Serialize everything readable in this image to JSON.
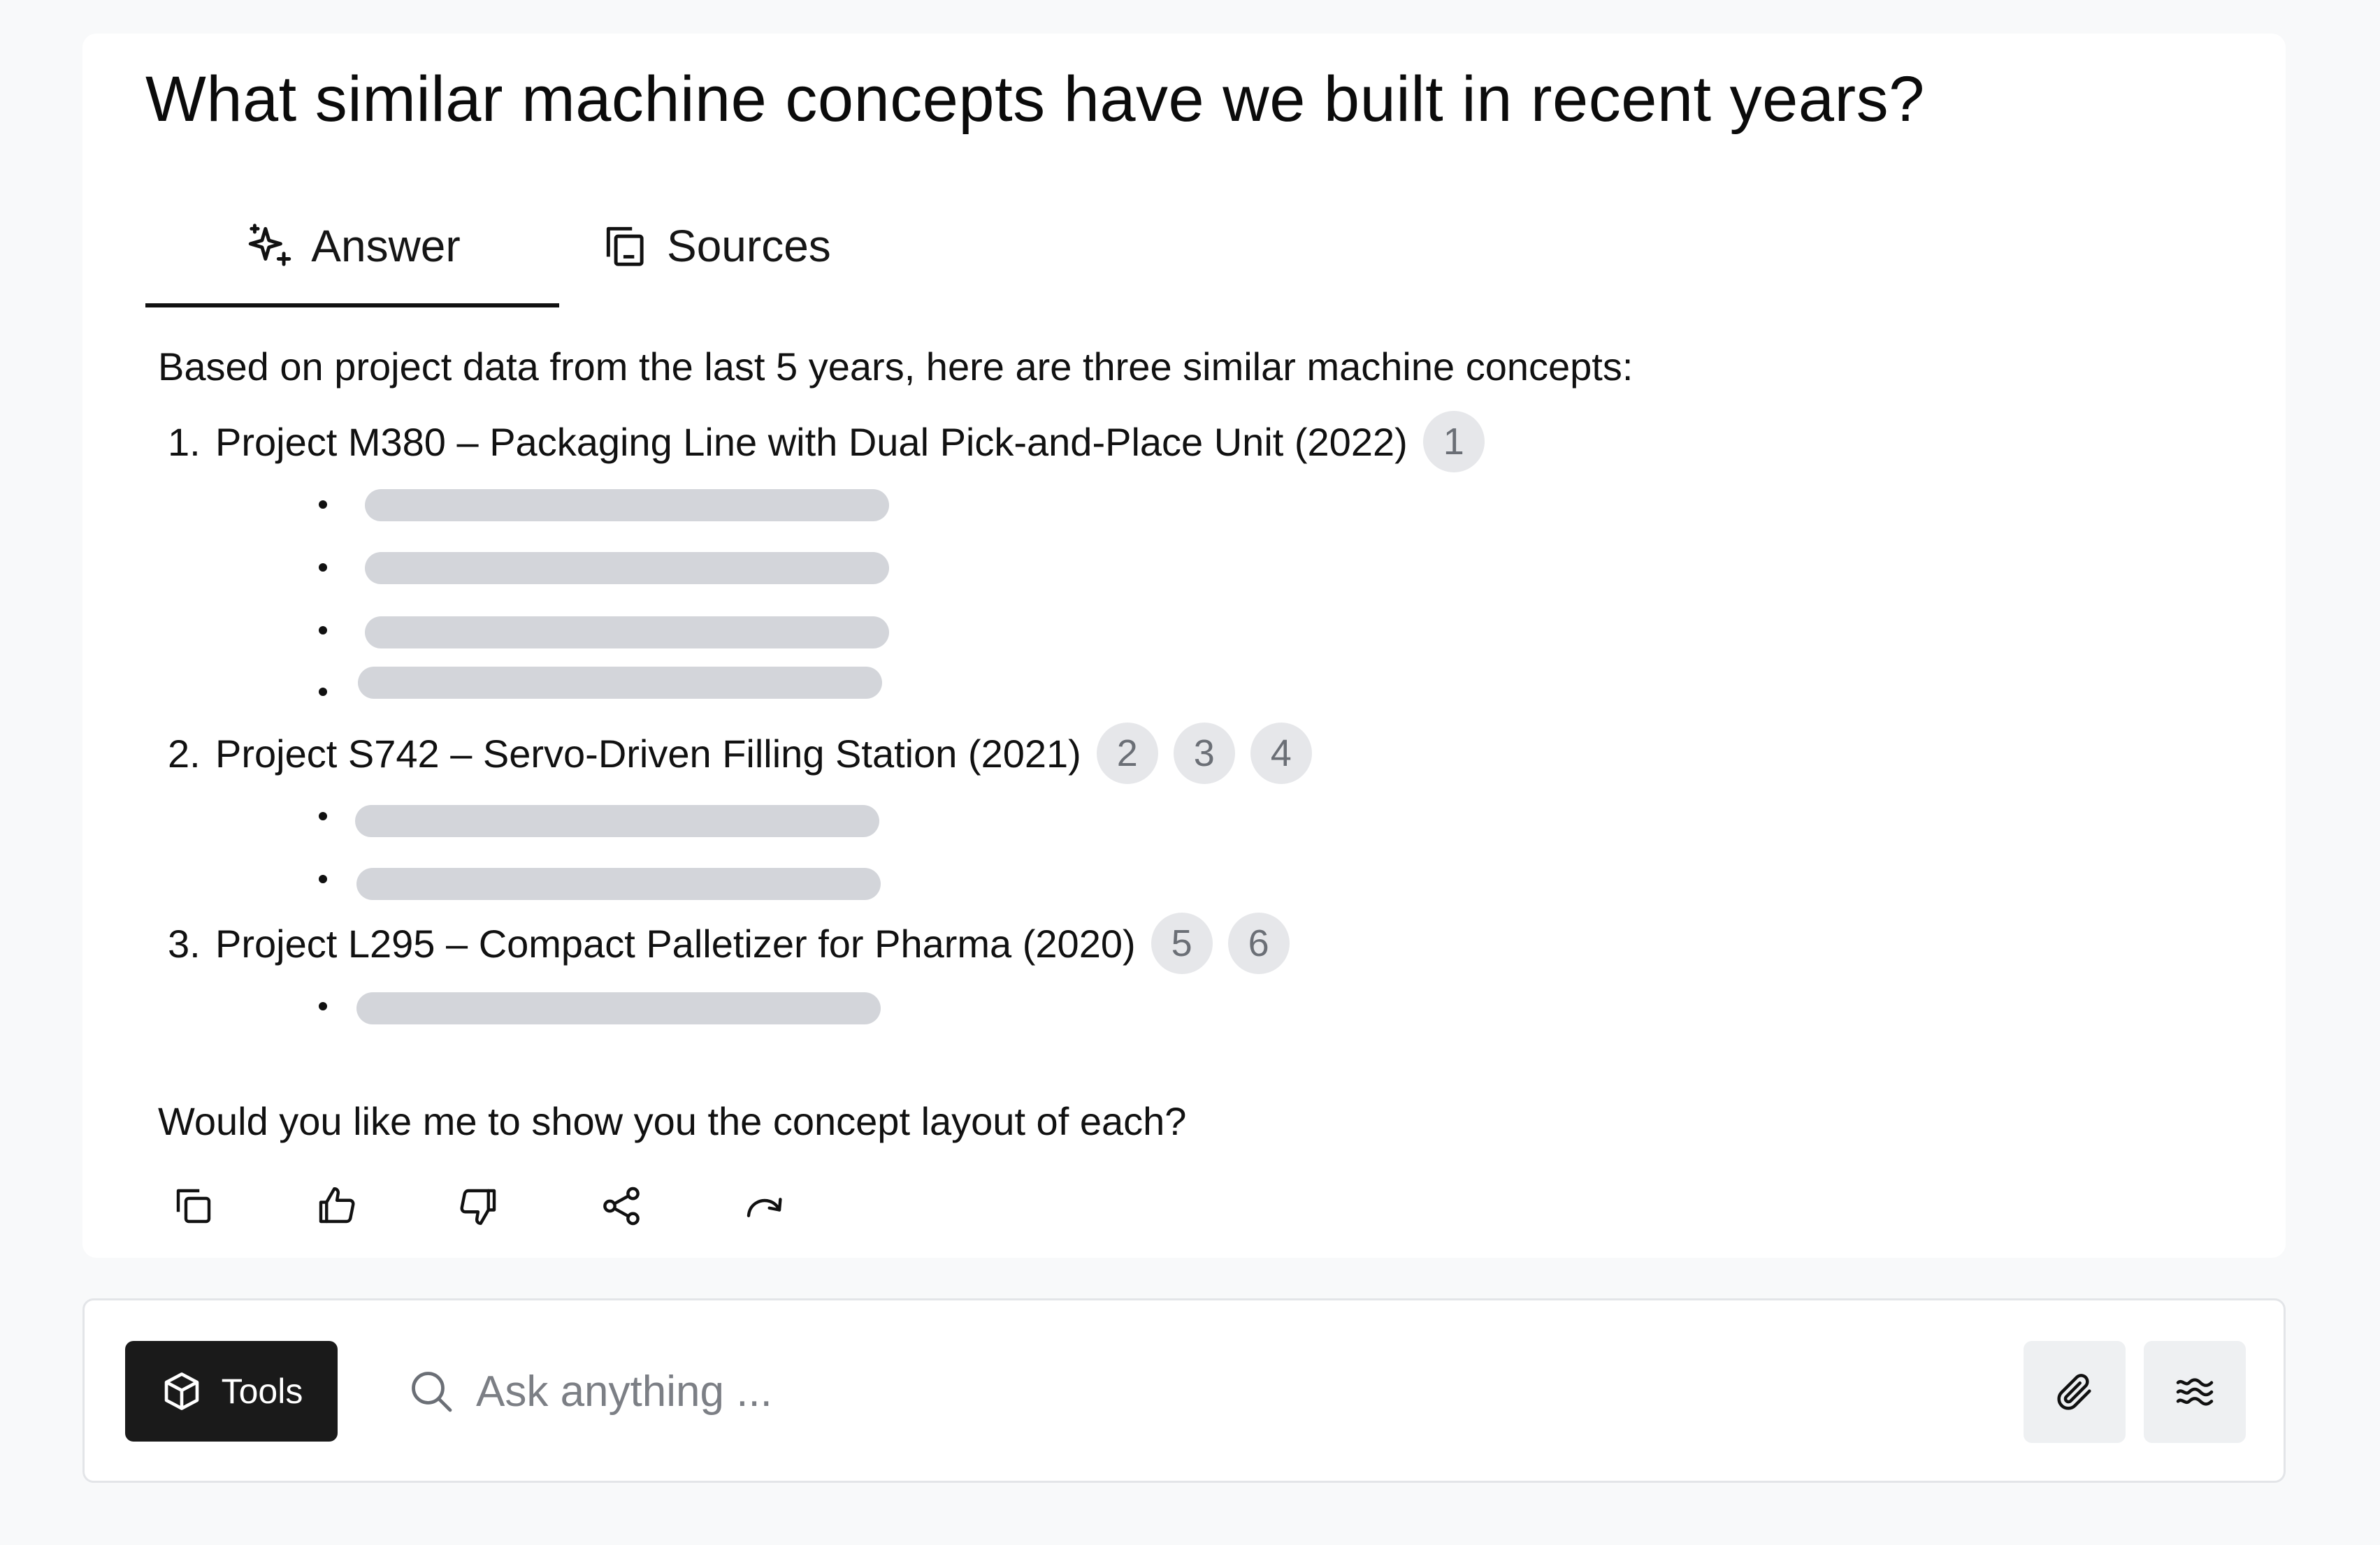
{
  "question": "What similar machine concepts have we built in recent years?",
  "tabs": [
    {
      "label": "Answer",
      "icon": "sparkles-icon",
      "active": true
    },
    {
      "label": "Sources",
      "icon": "documents-icon",
      "active": false
    }
  ],
  "answer": {
    "intro": "Based on project data from the last 5 years, here are three similar machine concepts:",
    "projects": [
      {
        "number": "1.",
        "title": "Project M380 – Packaging Line with Dual Pick-and-Place Unit (2022)",
        "citations": [
          "1"
        ],
        "placeholder_lines": 4
      },
      {
        "number": "2.",
        "title": "Project S742 – Servo-Driven Filling Station (2021)",
        "citations": [
          "2",
          "3",
          "4"
        ],
        "placeholder_lines": 2
      },
      {
        "number": "3.",
        "title": "Project L295 – Compact Palletizer for Pharma (2020)",
        "citations": [
          "5",
          "6"
        ],
        "placeholder_lines": 1
      }
    ],
    "closing": "Would you like me to show you the concept layout of each?"
  },
  "actions": [
    {
      "icon": "copy-icon"
    },
    {
      "icon": "thumbs-up-icon"
    },
    {
      "icon": "thumbs-down-icon"
    },
    {
      "icon": "share-icon"
    },
    {
      "icon": "redo-icon"
    }
  ],
  "composer": {
    "tools_label": "Tools",
    "tools_icon": "cube-icon",
    "search_icon": "search-icon",
    "placeholder": "Ask anything ...",
    "value": "",
    "attach_icon": "paperclip-icon",
    "voice_icon": "waves-icon"
  },
  "colors": {
    "page_background": "#f8f9fa",
    "card_background": "#ffffff",
    "text": "#111111",
    "citation_background": "#e6e7ea",
    "citation_text": "#6b6f76",
    "skeleton": "#d3d5da",
    "tools_button": "#1a1a1a",
    "icon_button_background": "#eef0f2"
  }
}
